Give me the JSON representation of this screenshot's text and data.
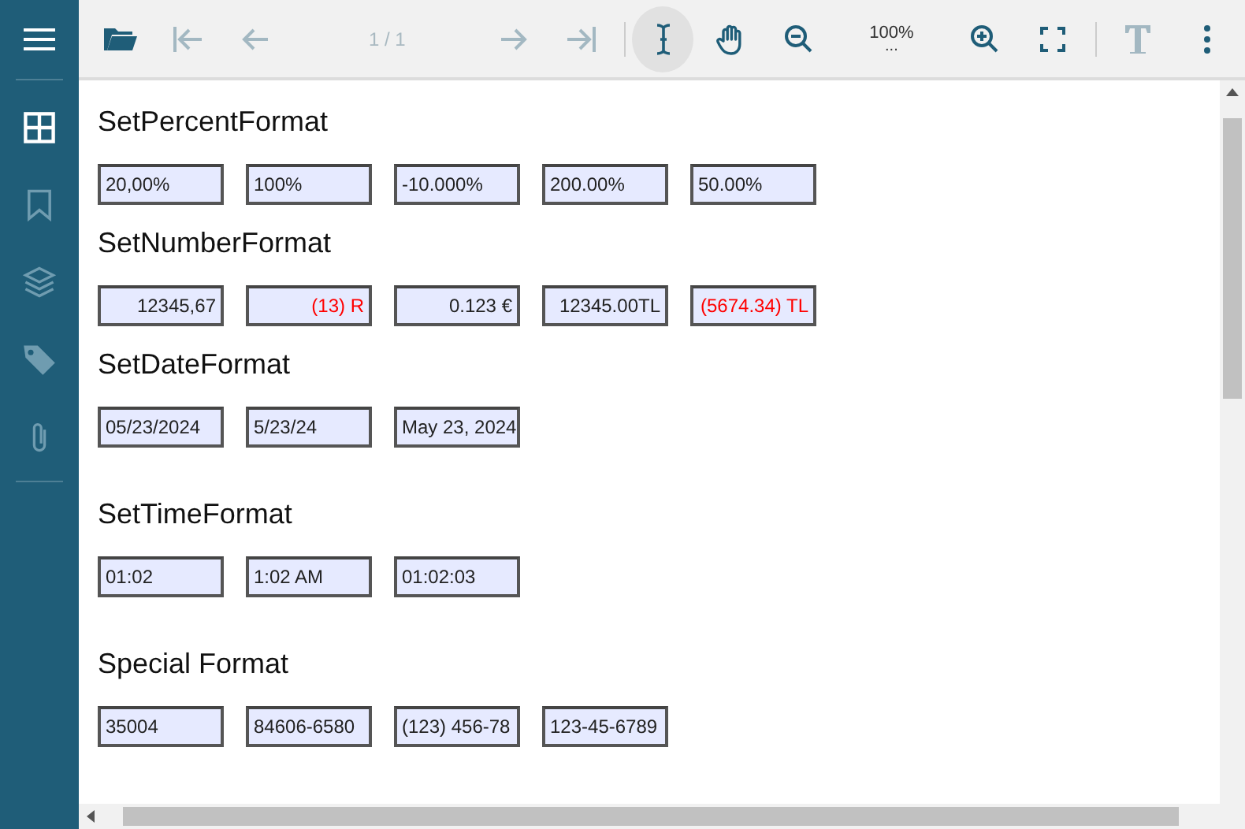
{
  "sidebar": {
    "items": [
      {
        "kind": "thumbnails",
        "selected": true
      },
      {
        "kind": "bookmarks",
        "selected": false
      },
      {
        "kind": "layers",
        "selected": false
      },
      {
        "kind": "tags",
        "selected": false
      },
      {
        "kind": "attachments",
        "selected": false
      }
    ]
  },
  "toolbar": {
    "nav": [
      {
        "kind": "first",
        "disabled": true
      },
      {
        "kind": "prev",
        "disabled": true
      }
    ],
    "page_indicator": "1 / 1",
    "nav_after": [
      {
        "kind": "next",
        "disabled": true
      },
      {
        "kind": "last",
        "disabled": true
      }
    ],
    "tools": [
      {
        "kind": "text-select",
        "selected": true
      },
      {
        "kind": "pan",
        "selected": false
      }
    ],
    "zoom": "100%",
    "zoom_more": "...",
    "annotate_disabled": true
  },
  "sections": [
    {
      "title": "SetPercentFormat",
      "fields": [
        {
          "value": "20,00%",
          "kind": "text",
          "negative": false
        },
        {
          "value": "100%",
          "kind": "text",
          "negative": false
        },
        {
          "value": "-10.000%",
          "kind": "text",
          "negative": false
        },
        {
          "value": "200.00%",
          "kind": "text",
          "negative": false
        },
        {
          "value": "50.00%",
          "kind": "text",
          "negative": false
        }
      ]
    },
    {
      "title": "SetNumberFormat",
      "fields": [
        {
          "value": "12345,67",
          "kind": "number",
          "negative": false
        },
        {
          "value": "(13) R",
          "kind": "number",
          "negative": true
        },
        {
          "value": "0.123 €",
          "kind": "number",
          "negative": false
        },
        {
          "value": "12345.00TL",
          "kind": "number",
          "negative": false
        },
        {
          "value": "(5674.34) TL",
          "kind": "number",
          "negative": true
        }
      ]
    },
    {
      "title": "SetDateFormat",
      "fields": [
        {
          "value": "05/23/2024",
          "kind": "text",
          "negative": false
        },
        {
          "value": "5/23/24",
          "kind": "text",
          "negative": false
        },
        {
          "value": "May 23, 2024",
          "kind": "text",
          "negative": false
        }
      ]
    },
    {
      "title": "SetTimeFormat",
      "fields": [
        {
          "value": "01:02",
          "kind": "text",
          "negative": false
        },
        {
          "value": "1:02 AM",
          "kind": "text",
          "negative": false
        },
        {
          "value": "01:02:03",
          "kind": "text",
          "negative": false
        }
      ]
    },
    {
      "title": "Special Format",
      "fields": [
        {
          "value": "35004",
          "kind": "text",
          "negative": false
        },
        {
          "value": "84606-6580",
          "kind": "text",
          "negative": false
        },
        {
          "value": "(123) 456-78",
          "kind": "text",
          "negative": false
        },
        {
          "value": "123-45-6789",
          "kind": "text",
          "negative": false
        }
      ]
    }
  ]
}
